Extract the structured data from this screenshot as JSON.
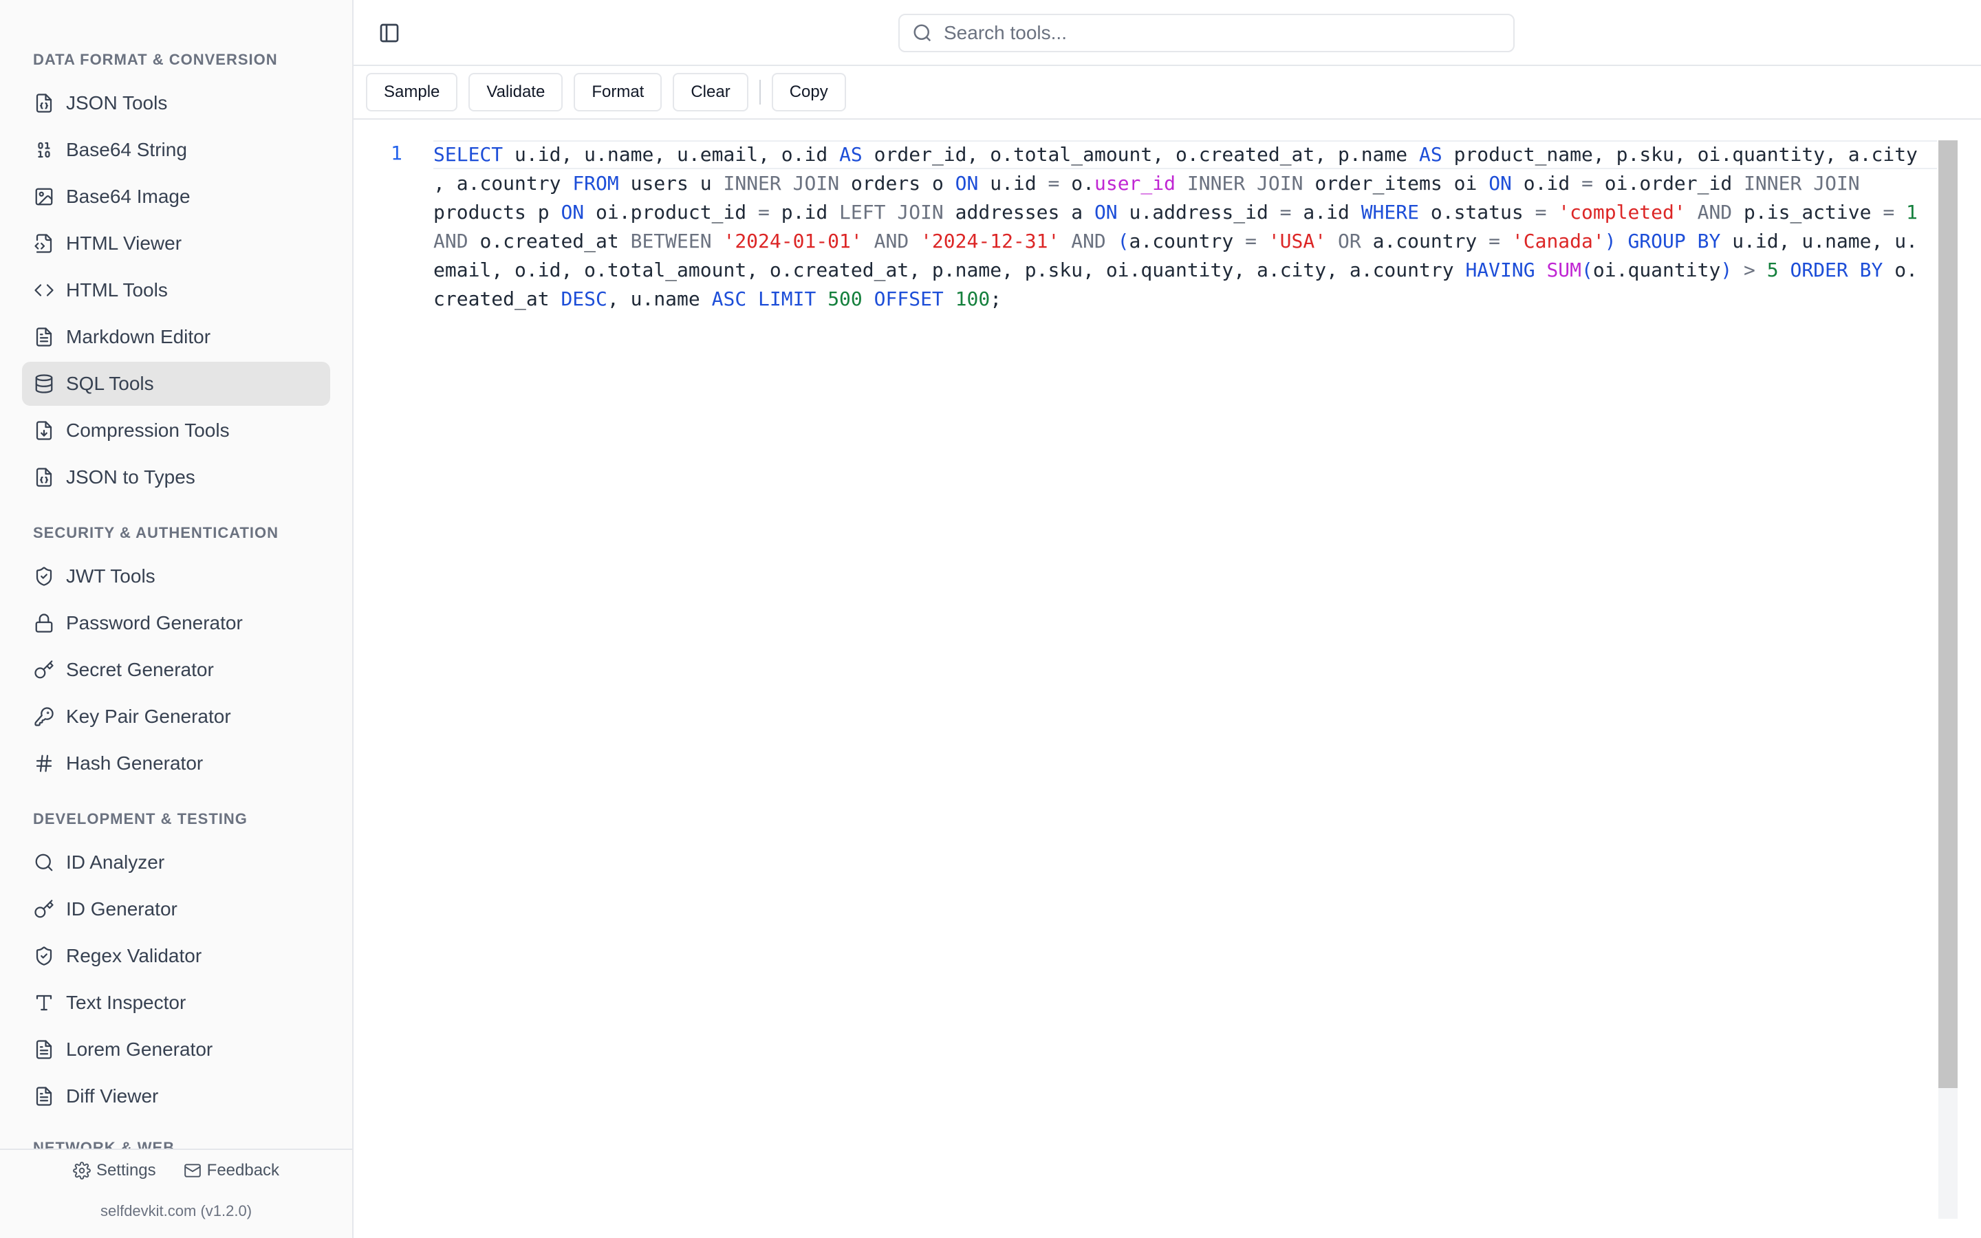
{
  "sidebar": {
    "groups": [
      {
        "title": "DATA FORMAT & CONVERSION",
        "items": [
          {
            "label": "JSON Tools",
            "icon": "file-json-icon"
          },
          {
            "label": "Base64 String",
            "icon": "binary-icon"
          },
          {
            "label": "Base64 Image",
            "icon": "image-icon"
          },
          {
            "label": "HTML Viewer",
            "icon": "file-code-icon"
          },
          {
            "label": "HTML Tools",
            "icon": "code-brackets-icon"
          },
          {
            "label": "Markdown Editor",
            "icon": "file-text-icon"
          },
          {
            "label": "SQL Tools",
            "icon": "database-icon",
            "active": true
          },
          {
            "label": "Compression Tools",
            "icon": "file-archive-icon"
          },
          {
            "label": "JSON to Types",
            "icon": "file-json-icon"
          }
        ]
      },
      {
        "title": "SECURITY & AUTHENTICATION",
        "items": [
          {
            "label": "JWT Tools",
            "icon": "shield-check-icon"
          },
          {
            "label": "Password Generator",
            "icon": "lock-icon"
          },
          {
            "label": "Secret Generator",
            "icon": "key-icon"
          },
          {
            "label": "Key Pair Generator",
            "icon": "key-round-icon"
          },
          {
            "label": "Hash Generator",
            "icon": "hash-icon"
          }
        ]
      },
      {
        "title": "DEVELOPMENT & TESTING",
        "items": [
          {
            "label": "ID Analyzer",
            "icon": "search-icon"
          },
          {
            "label": "ID Generator",
            "icon": "key-icon"
          },
          {
            "label": "Regex Validator",
            "icon": "shield-check-icon"
          },
          {
            "label": "Text Inspector",
            "icon": "type-icon"
          },
          {
            "label": "Lorem Generator",
            "icon": "file-text-icon"
          },
          {
            "label": "Diff Viewer",
            "icon": "file-diff-icon"
          }
        ]
      },
      {
        "title": "NETWORK & WEB",
        "items": []
      }
    ],
    "footer": {
      "settings_label": "Settings",
      "feedback_label": "Feedback",
      "version": "selfdevkit.com (v1.2.0)"
    }
  },
  "search": {
    "placeholder": "Search tools..."
  },
  "toolbar": {
    "sample_label": "Sample",
    "validate_label": "Validate",
    "format_label": "Format",
    "clear_label": "Clear",
    "copy_label": "Copy"
  },
  "editor": {
    "line_number": "1",
    "code": "SELECT u.id, u.name, u.email, o.id AS order_id, o.total_amount, o.created_at, p.name AS product_name, p.sku, oi.quantity, a.city, a.country FROM users u INNER JOIN orders o ON u.id = o.user_id INNER JOIN order_items oi ON o.id = oi.order_id INNER JOIN products p ON oi.product_id = p.id LEFT JOIN addresses a ON u.address_id = a.id WHERE o.status = 'completed' AND p.is_active = 1 AND o.created_at BETWEEN '2024-01-01' AND '2024-12-31' AND (a.country = 'USA' OR a.country = 'Canada') GROUP BY u.id, u.name, u.email, o.id, o.total_amount, o.created_at, p.name, p.sku, oi.quantity, a.city, a.country HAVING SUM(oi.quantity) > 5 ORDER BY o.created_at DESC, u.name ASC LIMIT 500 OFFSET 100;"
  },
  "colors": {
    "keyword": "#1d4ed8",
    "secondary_keyword": "#6b7280",
    "string": "#dc2626",
    "number": "#15803d",
    "function": "#c026d3",
    "active_item_bg": "#e5e5e5"
  }
}
